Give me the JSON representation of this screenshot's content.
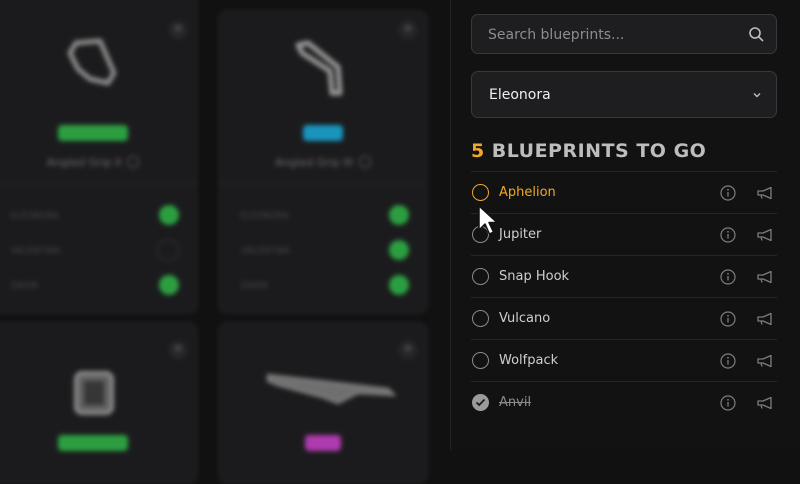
{
  "grid": {
    "cards": [
      {
        "name": "Angled Grip II",
        "rarity_color": "#2fae46",
        "shape": "grip-angled",
        "rows": [
          {
            "owner": "ELEONORA",
            "done": true
          },
          {
            "owner": "VALENTINA",
            "done": false
          },
          {
            "owner": "ZAHIR",
            "done": true
          }
        ]
      },
      {
        "name": "Angled Grip III",
        "rarity_color": "#1aa3d0",
        "shape": "grip-bent",
        "rows": [
          {
            "owner": "ELEONORA",
            "done": true
          },
          {
            "owner": "VALENTINA",
            "done": true
          },
          {
            "owner": "ZAHIR",
            "done": true
          }
        ]
      },
      {
        "name": "",
        "rarity_color": "#2fae46",
        "shape": "box",
        "rows": []
      },
      {
        "name": "",
        "rarity_color": "#c040c0",
        "shape": "rifle",
        "rows": []
      }
    ]
  },
  "panel": {
    "search": {
      "placeholder": "Search blueprints..."
    },
    "player_select": {
      "value": "Eleonora"
    },
    "heading": {
      "count": "5",
      "text": "BLUEPRINTS TO GO"
    },
    "accent_color": "#f0a828",
    "items": [
      {
        "name": "Aphelion",
        "state": "active"
      },
      {
        "name": "Jupiter",
        "state": "todo"
      },
      {
        "name": "Snap Hook",
        "state": "todo"
      },
      {
        "name": "Vulcano",
        "state": "todo"
      },
      {
        "name": "Wolfpack",
        "state": "todo"
      },
      {
        "name": "Anvil",
        "state": "done"
      }
    ]
  }
}
